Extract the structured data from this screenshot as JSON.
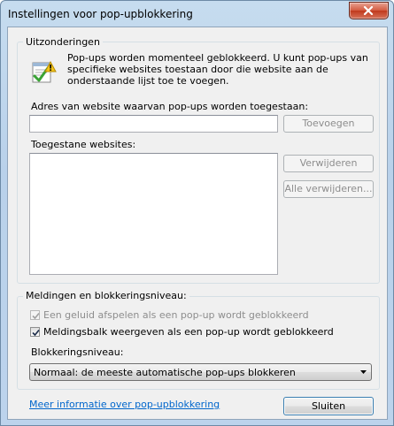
{
  "window": {
    "title": "Instellingen voor pop-upblokkering"
  },
  "exceptions": {
    "group_label": "Uitzonderingen",
    "description": "Pop-ups worden momenteel geblokkeerd. U kunt pop-ups van specifieke websites toestaan door die website aan de onderstaande lijst toe te voegen.",
    "address_label": "Adres van website waarvan pop-ups worden toegestaan:",
    "address_value": "",
    "add_button": "Toevoegen",
    "allowed_label": "Toegestane websites:",
    "allowed_sites": [],
    "remove_button": "Verwijderen",
    "remove_all_button": "Alle verwijderen..."
  },
  "notifications": {
    "group_label": "Meldingen en blokkeringsniveau:",
    "sound_checkbox": {
      "label": "Een geluid afspelen als een pop-up wordt geblokkeerd",
      "checked": true,
      "enabled": false
    },
    "infobar_checkbox": {
      "label": "Meldingsbalk weergeven als een pop-up wordt geblokkeerd",
      "checked": true,
      "enabled": true
    },
    "level_label": "Blokkeringsniveau:",
    "level_value": "Normaal: de meeste automatische pop-ups blokkeren"
  },
  "footer": {
    "more_info_link": "Meer informatie over pop-upblokkering",
    "close_button": "Sluiten"
  }
}
